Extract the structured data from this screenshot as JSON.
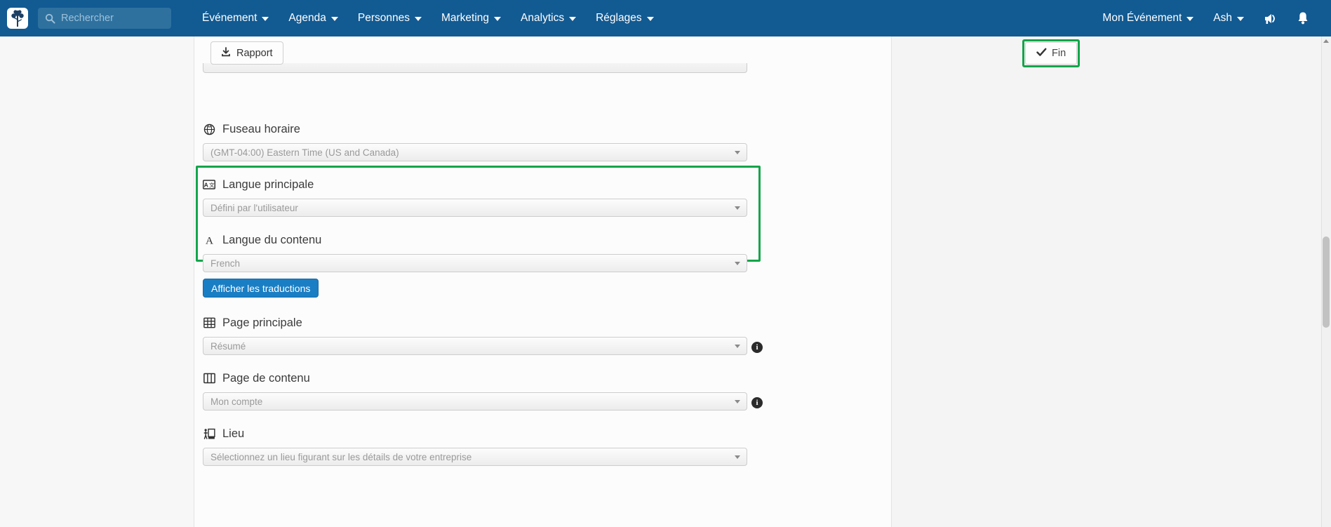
{
  "navbar": {
    "logo_icon": "tree-logo-icon",
    "search": {
      "icon": "search-icon",
      "placeholder": "Rechercher",
      "value": ""
    },
    "menu": [
      {
        "label": "Événement",
        "caret": true
      },
      {
        "label": "Agenda",
        "caret": true
      },
      {
        "label": "Personnes",
        "caret": true
      },
      {
        "label": "Marketing",
        "caret": true
      },
      {
        "label": "Analytics",
        "caret": true
      },
      {
        "label": "Réglages",
        "caret": true
      }
    ],
    "right_menu": [
      {
        "label": "Mon Événement",
        "caret": true
      },
      {
        "label": "Ash",
        "caret": true
      }
    ],
    "right_icons": [
      {
        "name": "megaphone-icon"
      },
      {
        "name": "bell-icon"
      }
    ],
    "colors": {
      "background": "#125a92",
      "search_field": "#2e719f",
      "text": "#ffffff"
    }
  },
  "toolbar": {
    "report_label": "Rapport",
    "report_icon": "download-icon",
    "done_label": "Fin",
    "done_icon": "check-icon",
    "done_highlight_color": "#13a54a"
  },
  "form": {
    "fields": [
      {
        "id": "timezone",
        "icon": "globe-icon",
        "label": "Fuseau horaire",
        "value": "(GMT-04:00) Eastern Time (US and Canada)",
        "info": false
      },
      {
        "id": "primary-language",
        "icon": "translate-icon",
        "label": "Langue principale",
        "value": "Défini par l'utilisateur",
        "info": false
      },
      {
        "id": "content-language",
        "icon": "letter-a-icon",
        "label": "Langue du contenu",
        "value": "French",
        "info": false
      },
      {
        "id": "main-page",
        "icon": "table-grid-icon",
        "label": "Page principale",
        "value": "Résumé",
        "info": true,
        "info_glyph": "i"
      },
      {
        "id": "content-page",
        "icon": "columns-icon",
        "label": "Page de contenu",
        "value": "Mon compte",
        "info": true,
        "info_glyph": "i"
      },
      {
        "id": "venue",
        "icon": "venue-podium-icon",
        "label": "Lieu",
        "value": "Sélectionnez un lieu figurant sur les détails de votre entreprise",
        "info": false
      }
    ],
    "translations_button": {
      "label": "Afficher les traductions",
      "color": "#1a7ec4"
    },
    "highlight": {
      "color": "#13a54a"
    }
  }
}
